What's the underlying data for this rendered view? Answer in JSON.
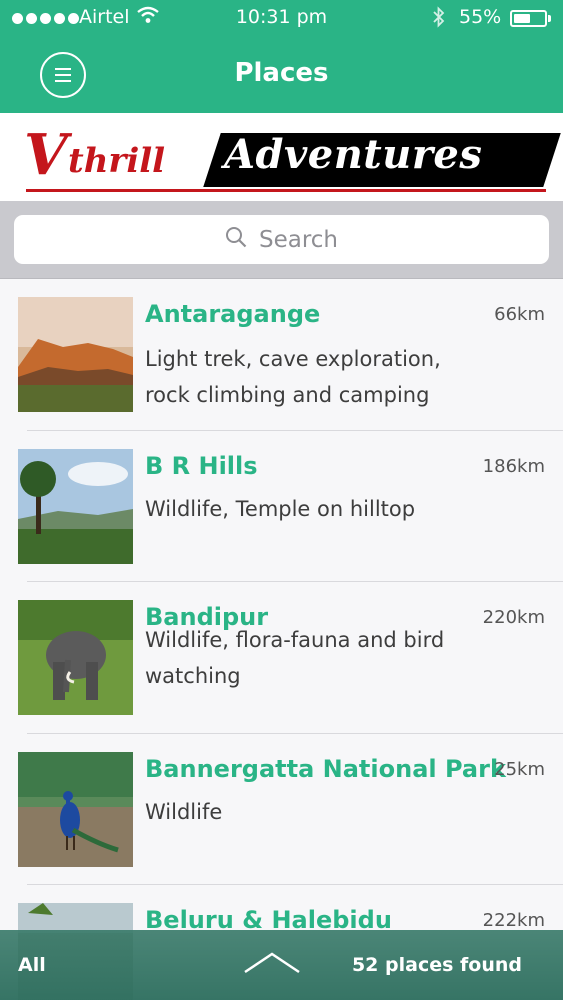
{
  "status_bar": {
    "carrier": "Airtel",
    "time": "10:31 pm",
    "battery_percent": "55%",
    "battery_level": 0.55
  },
  "nav": {
    "title": "Places"
  },
  "banner": {
    "logo_text_v": "V",
    "logo_text_rest": "thrill",
    "logo_text_black": "Adventures"
  },
  "search": {
    "placeholder": "Search"
  },
  "places": [
    {
      "name": "Antaragange",
      "distance": "66km",
      "description": "Light trek, cave exploration, rock climbing and camping",
      "thumb": "rocky-hill-sunset"
    },
    {
      "name": "B R Hills",
      "distance": "186km",
      "description": "Wildlife, Temple on hilltop",
      "thumb": "forest-hills"
    },
    {
      "name": "Bandipur",
      "distance": "220km",
      "description": "Wildlife, flora-fauna and bird watching",
      "thumb": "elephant"
    },
    {
      "name": "Bannergatta National Park",
      "distance": "25km",
      "description": "Wildlife",
      "thumb": "peacock"
    },
    {
      "name": "Beluru & Halebidu",
      "distance": "222km",
      "description": "",
      "thumb": "temple"
    }
  ],
  "bottom_bar": {
    "filter_label": "All",
    "count_label": "52 places found"
  },
  "colors": {
    "accent": "#2ab486",
    "logo_red": "#c4161c"
  }
}
